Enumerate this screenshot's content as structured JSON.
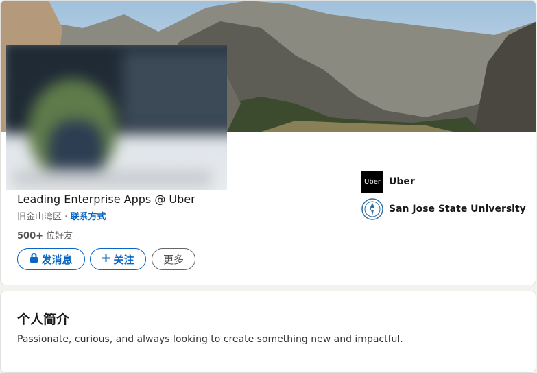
{
  "profile": {
    "headline": "Leading Enterprise Apps @ Uber",
    "location": "旧金山湾区",
    "separator": "·",
    "contact_label": "联系方式",
    "connections_count": "500+",
    "connections_suffix": "位好友"
  },
  "actions": {
    "message_label": "发消息",
    "follow_label": "关注",
    "more_label": "更多"
  },
  "organizations": [
    {
      "name": "Uber",
      "logo_text": "Uber"
    },
    {
      "name": "San Jose State University"
    }
  ],
  "about": {
    "title": "个人简介",
    "text": "Passionate, curious, and always looking to create something new and impactful."
  },
  "colors": {
    "accent": "#0a66c2",
    "background": "#f3f2ef"
  },
  "icons": [
    "lock-icon",
    "plus-icon"
  ]
}
